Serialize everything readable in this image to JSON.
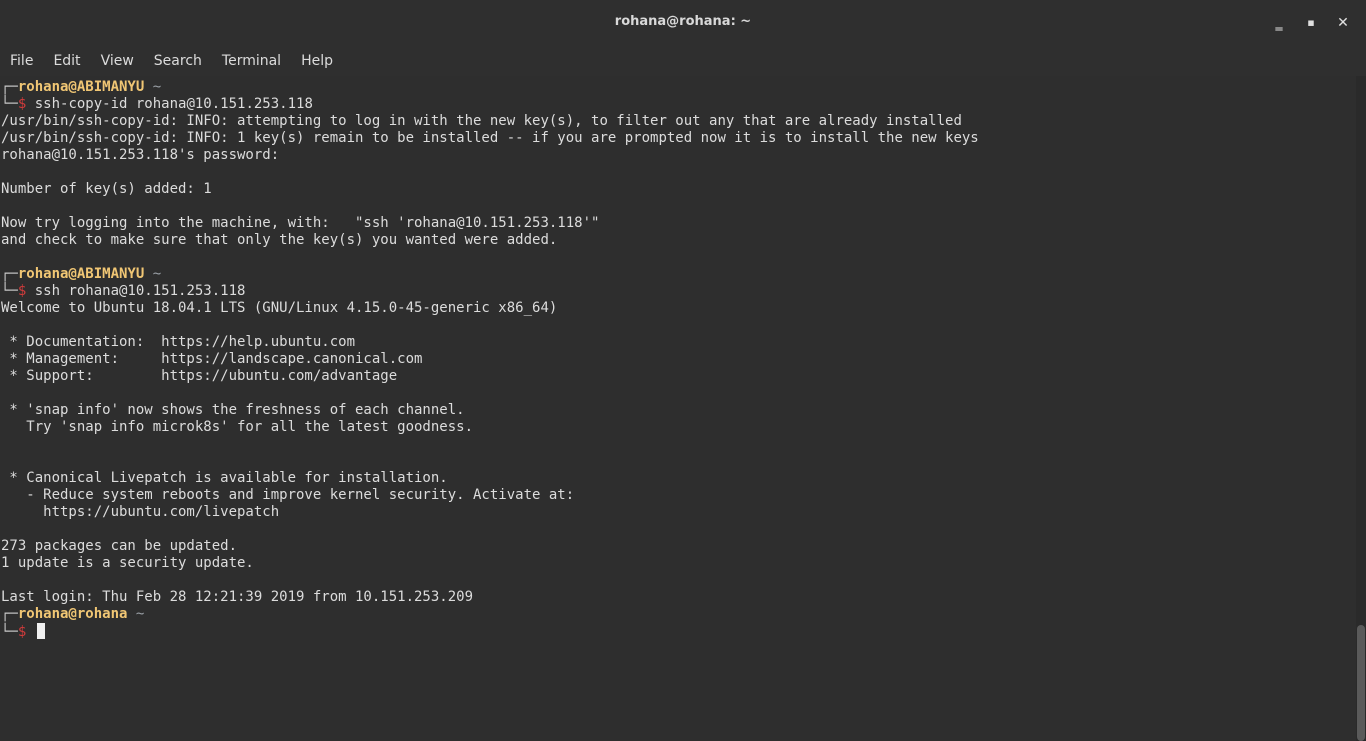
{
  "window": {
    "title": "rohana@rohana: ~",
    "minimize_icon": "minimize-icon",
    "maximize_icon": "maximize-icon",
    "close_icon": "close-icon",
    "minimize_glyph": "‗",
    "maximize_glyph": "▪",
    "close_glyph": "✕"
  },
  "menu": {
    "items": [
      "File",
      "Edit",
      "View",
      "Search",
      "Terminal",
      "Help"
    ]
  },
  "terminal": {
    "colors": {
      "background": "#2e2e2e",
      "text": "#dcdcdc",
      "prompt_user": "#f0c674",
      "prompt_dollar": "#d03b3b"
    },
    "prompts": [
      {
        "corner_top": "┌─",
        "user": "rohana@ABIMANYU",
        "tilde": "~",
        "corner_bottom": "└─",
        "dollar": "$",
        "command": " ssh-copy-id rohana@10.151.253.118"
      },
      {
        "corner_top": "┌─",
        "user": "rohana@ABIMANYU",
        "tilde": "~",
        "corner_bottom": "└─",
        "dollar": "$",
        "command": " ssh rohana@10.151.253.118"
      },
      {
        "corner_top": "┌─",
        "user": "rohana@rohana",
        "tilde": "~",
        "corner_bottom": "└─",
        "dollar": "$",
        "command": " "
      }
    ],
    "output1": [
      "/usr/bin/ssh-copy-id: INFO: attempting to log in with the new key(s), to filter out any that are already installed",
      "/usr/bin/ssh-copy-id: INFO: 1 key(s) remain to be installed -- if you are prompted now it is to install the new keys",
      "rohana@10.151.253.118's password:",
      "",
      "Number of key(s) added: 1",
      "",
      "Now try logging into the machine, with:   \"ssh 'rohana@10.151.253.118'\"",
      "and check to make sure that only the key(s) you wanted were added.",
      ""
    ],
    "output2": [
      "Welcome to Ubuntu 18.04.1 LTS (GNU/Linux 4.15.0-45-generic x86_64)",
      "",
      " * Documentation:  https://help.ubuntu.com",
      " * Management:     https://landscape.canonical.com",
      " * Support:        https://ubuntu.com/advantage",
      "",
      " * 'snap info' now shows the freshness of each channel.",
      "   Try 'snap info microk8s' for all the latest goodness.",
      "",
      "",
      " * Canonical Livepatch is available for installation.",
      "   - Reduce system reboots and improve kernel security. Activate at:",
      "     https://ubuntu.com/livepatch",
      "",
      "273 packages can be updated.",
      "1 update is a security update.",
      "",
      "Last login: Thu Feb 28 12:21:39 2019 from 10.151.253.209"
    ]
  },
  "scrollbar": {
    "position": 1.0
  }
}
